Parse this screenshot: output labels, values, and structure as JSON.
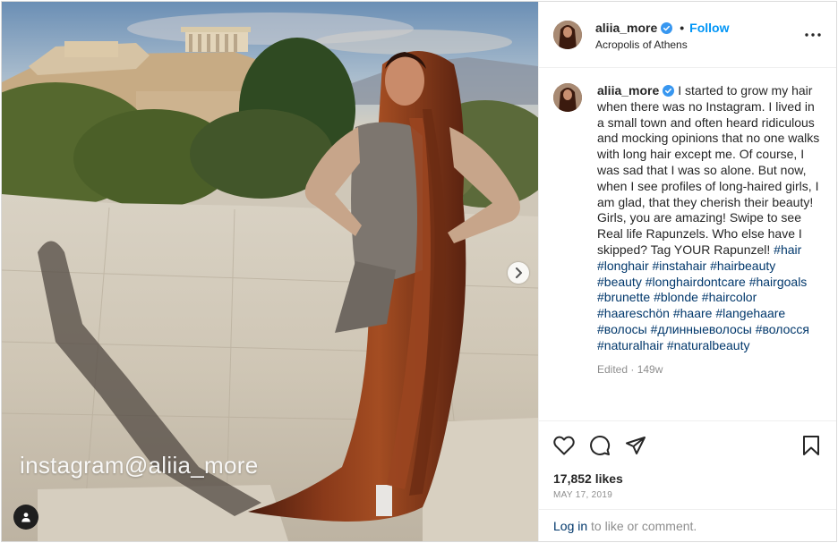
{
  "post": {
    "username": "aliia_more",
    "location": "Acropolis of Athens",
    "follow_label": "Follow",
    "header_separator": "•",
    "watermark": "instagram@aliia_more",
    "caption_text": "I started to grow my hair when there was no Instagram. I lived in a small town and often heard ridiculous and mocking opinions that no one walks with long hair except me. Of course, I was sad that I was so alone. But now, when I see profiles of long-haired girls, I am glad, that they cherish their beauty! Girls, you are amazing! Swipe to see Real life Rapunzels. Who else have I skipped? Tag YOUR Rapunzel!",
    "hashtags": [
      "#hair",
      "#longhair",
      "#instahair",
      "#hairbeauty",
      "#beauty",
      "#longhairdontcare",
      "#hairgoals",
      "#brunette",
      "#blonde",
      "#haircolor",
      "#haareschön",
      "#haare",
      "#langehaare",
      "#волосы",
      "#длинныеволосы",
      "#волосся",
      "#naturalhair",
      "#naturalbeauty"
    ],
    "edited": "Edited · 149w",
    "likes": "17,852 likes",
    "date": "MAY 17, 2019",
    "login_link": "Log in",
    "login_suffix": " to like or comment."
  },
  "icons": {
    "verified": "verified-badge-icon",
    "more": "more-options-icon",
    "like": "heart-icon",
    "comment": "comment-icon",
    "share": "paper-plane-icon",
    "save": "bookmark-icon",
    "next": "chevron-right-icon",
    "tags": "user-tag-icon"
  },
  "colors": {
    "link_blue": "#0095f6",
    "hashtag": "#00376b",
    "muted": "#8e8e8e",
    "text": "#262626",
    "verified": "#3897f0"
  }
}
